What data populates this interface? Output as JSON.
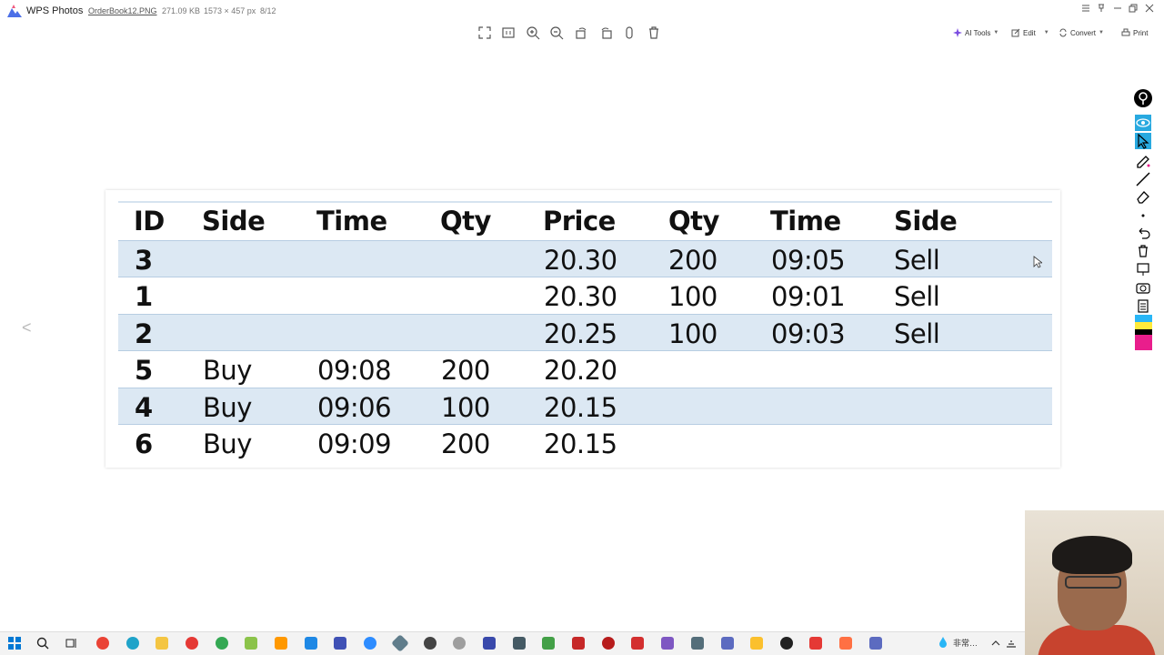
{
  "app": {
    "title": "WPS Photos",
    "file_name": "OrderBook12.PNG",
    "file_size": "271.09 KB",
    "file_dims": "1573 × 457 px",
    "file_pos": "8/12"
  },
  "toolbar_right": {
    "ai_tools": "AI Tools",
    "edit": "Edit",
    "convert": "Convert",
    "print": "Print"
  },
  "table": {
    "headers": [
      "ID",
      "Side",
      "Time",
      "Qty",
      "Price",
      "Qty",
      "Time",
      "Side"
    ],
    "rows": [
      {
        "id": "3",
        "bid_side": "",
        "bid_time": "",
        "bid_qty": "",
        "price": "20.30",
        "ask_qty": "200",
        "ask_time": "09:05",
        "ask_side": "Sell",
        "shaded": true
      },
      {
        "id": "1",
        "bid_side": "",
        "bid_time": "",
        "bid_qty": "",
        "price": "20.30",
        "ask_qty": "100",
        "ask_time": "09:01",
        "ask_side": "Sell",
        "shaded": false
      },
      {
        "id": "2",
        "bid_side": "",
        "bid_time": "",
        "bid_qty": "",
        "price": "20.25",
        "ask_qty": "100",
        "ask_time": "09:03",
        "ask_side": "Sell",
        "shaded": true
      },
      {
        "id": "5",
        "bid_side": "Buy",
        "bid_time": "09:08",
        "bid_qty": "200",
        "price": "20.20",
        "ask_qty": "",
        "ask_time": "",
        "ask_side": "",
        "shaded": false
      },
      {
        "id": "4",
        "bid_side": "Buy",
        "bid_time": "09:06",
        "bid_qty": "100",
        "price": "20.15",
        "ask_qty": "",
        "ask_time": "",
        "ask_side": "",
        "shaded": true
      },
      {
        "id": "6",
        "bid_side": "Buy",
        "bid_time": "09:09",
        "bid_qty": "200",
        "price": "20.15",
        "ask_qty": "",
        "ask_time": "",
        "ask_side": "",
        "shaded": false
      }
    ]
  },
  "tray": {
    "ime": "非常…"
  },
  "colors": {
    "row_shade": "#dce8f3",
    "accent_blue": "#28a9e0",
    "swatch_cyan": "#29b6f6",
    "swatch_yellow": "#ffeb3b",
    "swatch_black": "#000000",
    "swatch_magenta": "#e91e8c"
  }
}
